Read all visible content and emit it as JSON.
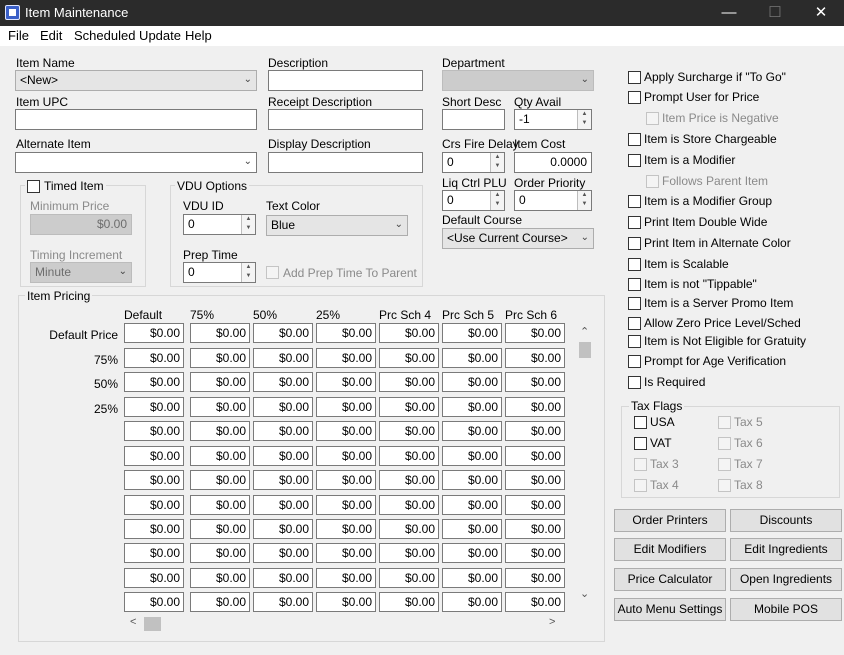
{
  "window": {
    "title": "Item Maintenance",
    "controls": {
      "minimize": "—",
      "maximize": "☐",
      "close": "✕"
    }
  },
  "menu": [
    "File",
    "Edit",
    "Scheduled Update",
    "Help"
  ],
  "fields": {
    "item_name": {
      "label": "Item Name",
      "value": "<New>"
    },
    "item_upc": {
      "label": "Item UPC",
      "value": ""
    },
    "alternate_item": {
      "label": "Alternate Item",
      "value": ""
    },
    "description": {
      "label": "Description",
      "value": ""
    },
    "receipt_description": {
      "label": "Receipt Description",
      "value": ""
    },
    "display_description": {
      "label": "Display Description",
      "value": ""
    },
    "department": {
      "label": "Department",
      "value": ""
    },
    "short_desc": {
      "label": "Short Desc",
      "value": ""
    },
    "qty_avail": {
      "label": "Qty Avail",
      "value": "-1"
    },
    "crs_fire_delay": {
      "label": "Crs Fire Delay",
      "value": "0"
    },
    "item_cost": {
      "label": "Item Cost",
      "value": "0.0000"
    },
    "liq_ctrl_plu": {
      "label": "Liq Ctrl PLU",
      "value": "0"
    },
    "order_priority": {
      "label": "Order Priority",
      "value": "0"
    },
    "default_course": {
      "label": "Default Course",
      "value": "<Use Current Course>"
    }
  },
  "timed": {
    "label": "Timed Item",
    "min_price_label": "Minimum Price",
    "min_price": "$0.00",
    "timing_increment_label": "Timing Increment",
    "timing_increment": "Minute"
  },
  "vdu": {
    "group": "VDU Options",
    "vdu_id_label": "VDU ID",
    "vdu_id": "0",
    "text_color_label": "Text Color",
    "text_color": "Blue",
    "prep_time_label": "Prep Time",
    "prep_time": "0",
    "add_prep_label": "Add Prep Time To Parent"
  },
  "pricing": {
    "group": "Item Pricing",
    "columns": [
      "Default",
      "75%",
      "50%",
      "25%",
      "Prc Sch 4",
      "Prc Sch 5",
      "Prc Sch 6"
    ],
    "row_labels": [
      "Default Price",
      "75%",
      "50%",
      "25%",
      "",
      "",
      "",
      "",
      "",
      "",
      "",
      ""
    ],
    "cell_value": "$0.00"
  },
  "options": [
    {
      "label": "Apply Surcharge if \"To Go\"",
      "enabled": true
    },
    {
      "label": "Prompt User for Price",
      "enabled": true
    },
    {
      "label": "Item Price is Negative",
      "enabled": false
    },
    {
      "label": "Item is Store Chargeable",
      "enabled": true
    },
    {
      "label": "Item is a Modifier",
      "enabled": true
    },
    {
      "label": "Follows Parent Item",
      "enabled": false
    },
    {
      "label": "Item is a Modifier Group",
      "enabled": true
    },
    {
      "label": "Print Item Double Wide",
      "enabled": true
    },
    {
      "label": "Print Item in Alternate Color",
      "enabled": true
    },
    {
      "label": "Item is Scalable",
      "enabled": true
    },
    {
      "label": "Item is not \"Tippable\"",
      "enabled": true
    },
    {
      "label": "Item is a Server Promo Item",
      "enabled": true
    },
    {
      "label": "Allow Zero Price Level/Sched",
      "enabled": true
    },
    {
      "label": "Item is Not Eligible for Gratuity",
      "enabled": true
    },
    {
      "label": "Prompt for Age Verification",
      "enabled": true
    },
    {
      "label": "Is Required",
      "enabled": true
    }
  ],
  "tax": {
    "group": "Tax Flags",
    "left": [
      {
        "label": "USA",
        "enabled": true
      },
      {
        "label": "VAT",
        "enabled": true
      },
      {
        "label": "Tax 3",
        "enabled": false
      },
      {
        "label": "Tax 4",
        "enabled": false
      }
    ],
    "right": [
      {
        "label": "Tax 5",
        "enabled": false
      },
      {
        "label": "Tax 6",
        "enabled": false
      },
      {
        "label": "Tax 7",
        "enabled": false
      },
      {
        "label": "Tax 8",
        "enabled": false
      }
    ]
  },
  "buttons": [
    [
      "Order Printers",
      "Discounts"
    ],
    [
      "Edit Modifiers",
      "Edit Ingredients"
    ],
    [
      "Price Calculator",
      "Open Ingredients"
    ],
    [
      "Auto Menu Settings",
      "Mobile POS"
    ]
  ]
}
